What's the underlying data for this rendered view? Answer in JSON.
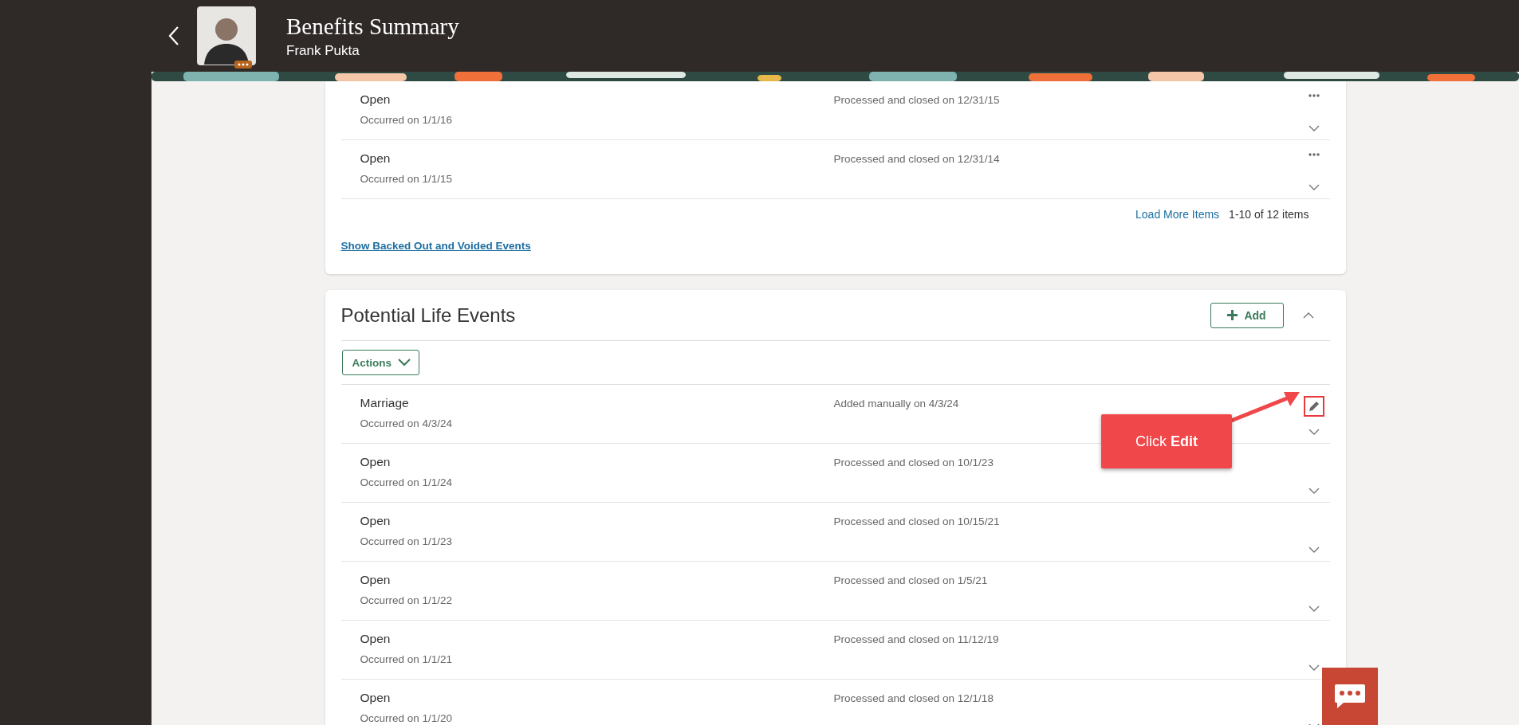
{
  "header": {
    "title": "Benefits Summary",
    "name": "Frank Pukta"
  },
  "completed_events": {
    "rows": [
      {
        "name": "Open",
        "occurred": "Occurred on 1/1/16",
        "status": "Processed and closed on 12/31/15",
        "kind": "more"
      },
      {
        "name": "Open",
        "occurred": "Occurred on 1/1/15",
        "status": "Processed and closed on 12/31/14",
        "kind": "more"
      }
    ],
    "load_more": "Load More Items",
    "count": "1-10 of 12 items",
    "show_link": "Show Backed Out and Voided Events"
  },
  "potential_life_events": {
    "title": "Potential Life Events",
    "add_button": "Add",
    "expanded": true,
    "actions_button": "Actions",
    "rows": [
      {
        "name": "Marriage",
        "occurred": "Occurred on 4/3/24",
        "status": "Added manually on 4/3/24",
        "kind": "edit",
        "highlighted": true
      },
      {
        "name": "Open",
        "occurred": "Occurred on 1/1/24",
        "status": "Processed and closed on 10/1/23",
        "kind": "plain",
        "highlighted": false
      },
      {
        "name": "Open",
        "occurred": "Occurred on 1/1/23",
        "status": "Processed and closed on 10/15/21",
        "kind": "plain",
        "highlighted": false
      },
      {
        "name": "Open",
        "occurred": "Occurred on 1/1/22",
        "status": "Processed and closed on 1/5/21",
        "kind": "plain",
        "highlighted": false
      },
      {
        "name": "Open",
        "occurred": "Occurred on 1/1/21",
        "status": "Processed and closed on 11/12/19",
        "kind": "plain",
        "highlighted": false
      },
      {
        "name": "Open",
        "occurred": "Occurred on 1/1/20",
        "status": "Processed and closed on 12/1/18",
        "kind": "plain",
        "highlighted": false
      }
    ]
  },
  "callout": {
    "text": "Click **Edit**"
  }
}
